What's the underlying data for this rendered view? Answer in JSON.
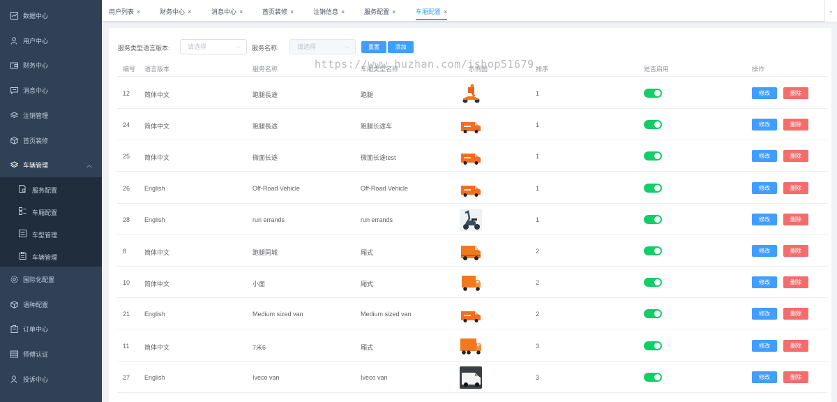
{
  "sidebar": {
    "items": [
      {
        "label": "数据中心",
        "icon": "chart-icon"
      },
      {
        "label": "用户中心",
        "icon": "user-icon"
      },
      {
        "label": "财务中心",
        "icon": "wallet-icon"
      },
      {
        "label": "消息中心",
        "icon": "message-icon"
      },
      {
        "label": "注销管理",
        "icon": "layers-icon"
      },
      {
        "label": "首页装修",
        "icon": "box-icon"
      },
      {
        "label": "车辆管理",
        "icon": "layers-icon"
      },
      {
        "label": "国际化配置",
        "icon": "gear-icon"
      },
      {
        "label": "语种配置",
        "icon": "box-icon"
      },
      {
        "label": "订单中心",
        "icon": "clipboard-icon"
      },
      {
        "label": "师傅认证",
        "icon": "stack-icon"
      },
      {
        "label": "投诉中心",
        "icon": "user-icon"
      }
    ],
    "submenu": [
      {
        "label": "服务配置",
        "icon": "document-gear-icon"
      },
      {
        "label": "车厢配置",
        "icon": "grid-icon"
      },
      {
        "label": "车型管理",
        "icon": "list-icon"
      },
      {
        "label": "车辆管理",
        "icon": "clipboard-icon"
      }
    ]
  },
  "tabs": [
    {
      "label": "用户列表",
      "active": false
    },
    {
      "label": "财务中心",
      "active": false
    },
    {
      "label": "消息中心",
      "active": false
    },
    {
      "label": "首页装修",
      "active": false
    },
    {
      "label": "注销信息",
      "active": false
    },
    {
      "label": "服务配置",
      "active": false
    },
    {
      "label": "车厢配置",
      "active": true
    }
  ],
  "tab_close": "×",
  "filters": {
    "language_label": "服务类型语言版本:",
    "language_placeholder": "请选择",
    "service_label": "服务名称:",
    "service_placeholder": "请选择",
    "reset_button": "重置",
    "add_button": "添加"
  },
  "table": {
    "headers": [
      "编号",
      "语言版本",
      "服务名称",
      "车厢类型名称",
      "示例图",
      "排序",
      "是否启用",
      "操作"
    ],
    "rows": [
      {
        "id": "12",
        "lang": "简体中文",
        "service": "跑腿長途",
        "type": "跑腿",
        "sort": "1",
        "enabled": true,
        "image": "scooter-rider"
      },
      {
        "id": "24",
        "lang": "简体中文",
        "service": "跑腿長途",
        "type": "跑腿长途车",
        "sort": "1",
        "enabled": true,
        "image": "orange-van"
      },
      {
        "id": "25",
        "lang": "简体中文",
        "service": "微面长途",
        "type": "微面长途test",
        "sort": "1",
        "enabled": true,
        "image": "orange-van"
      },
      {
        "id": "26",
        "lang": "English",
        "service": "Off-Road Vehicle",
        "type": "Off-Road Vehicle",
        "sort": "1",
        "enabled": true,
        "image": "orange-van"
      },
      {
        "id": "28",
        "lang": "English",
        "service": "run errands",
        "type": "run errands",
        "sort": "1",
        "enabled": true,
        "image": "scooter"
      },
      {
        "id": "8",
        "lang": "简体中文",
        "service": "跑腿同城",
        "type": "厢式",
        "sort": "2",
        "enabled": true,
        "image": "orange-box-van"
      },
      {
        "id": "10",
        "lang": "简体中文",
        "service": "小面",
        "type": "厢式",
        "sort": "2",
        "enabled": true,
        "image": "orange-truck"
      },
      {
        "id": "21",
        "lang": "English",
        "service": "Medium sized van",
        "type": "Medium sized van",
        "sort": "2",
        "enabled": true,
        "image": "orange-van"
      },
      {
        "id": "11",
        "lang": "简体中文",
        "service": "7米6",
        "type": "厢式",
        "sort": "3",
        "enabled": true,
        "image": "orange-big-truck"
      },
      {
        "id": "27",
        "lang": "English",
        "service": "Iveco van",
        "type": "Iveco van",
        "sort": "3",
        "enabled": true,
        "image": "white-van"
      }
    ],
    "edit_label": "修改",
    "delete_label": "删除"
  },
  "watermark": "https://www.huzhan.com/ishop51679",
  "colors": {
    "sidebar": "#304156",
    "submenu": "#1f2d3d",
    "primary": "#409eff",
    "danger": "#f56c6c",
    "switch_on": "#13ce66"
  }
}
